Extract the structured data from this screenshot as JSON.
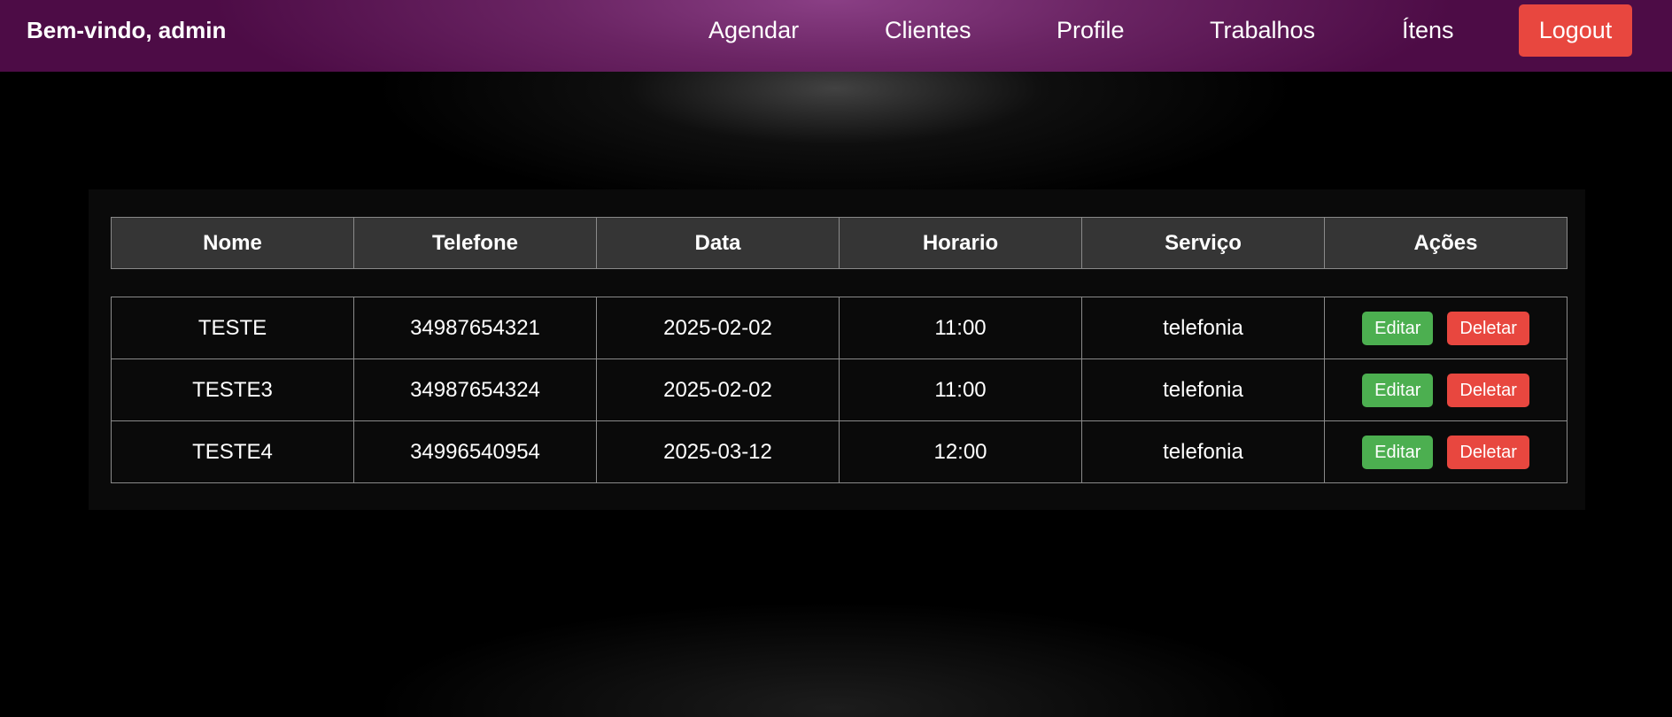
{
  "header": {
    "welcome": "Bem-vindo, admin",
    "nav": [
      {
        "label": "Agendar"
      },
      {
        "label": "Clientes"
      },
      {
        "label": "Profile"
      },
      {
        "label": "Trabalhos"
      },
      {
        "label": "Ítens"
      }
    ],
    "logout_label": "Logout"
  },
  "table": {
    "columns": [
      "Nome",
      "Telefone",
      "Data",
      "Horario",
      "Serviço",
      "Ações"
    ],
    "rows": [
      {
        "nome": "TESTE",
        "telefone": "34987654321",
        "data": "2025-02-02",
        "horario": "11:00",
        "servico": "telefonia"
      },
      {
        "nome": "TESTE3",
        "telefone": "34987654324",
        "data": "2025-02-02",
        "horario": "11:00",
        "servico": "telefonia"
      },
      {
        "nome": "TESTE4",
        "telefone": "34996540954",
        "data": "2025-03-12",
        "horario": "12:00",
        "servico": "telefonia"
      }
    ],
    "edit_label": "Editar",
    "delete_label": "Deletar"
  },
  "colors": {
    "navbar": "#6a2463",
    "logout": "#e8473f",
    "edit": "#4caf50",
    "delete": "#e8473f"
  }
}
